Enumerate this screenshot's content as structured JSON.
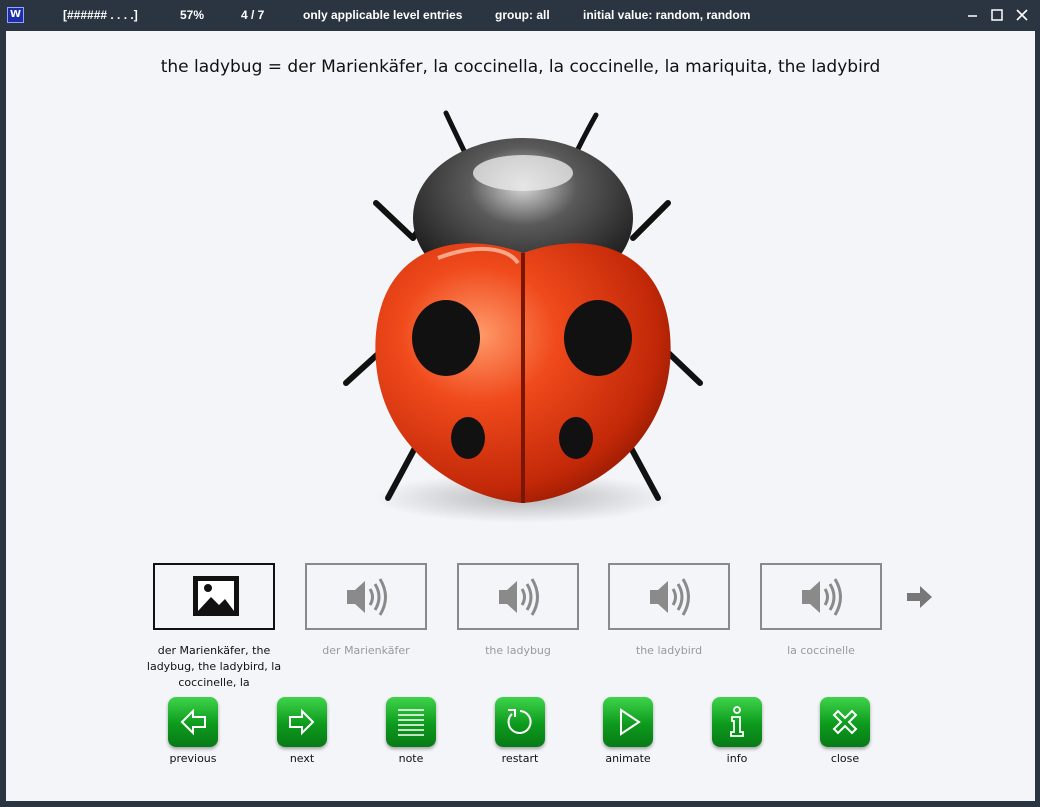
{
  "titlebar": {
    "app_icon_label": "W",
    "progress_text": "[###### . . . .]",
    "percent": "57%",
    "count": "4 / 7",
    "filter": "only applicable level entries",
    "group": "group: all",
    "initial_value": "initial value: random, random"
  },
  "heading": "the ladybug = der Marienkäfer, la coccinella, la coccinelle, la mariquita, the ladybird",
  "cards": [
    {
      "type": "image",
      "label": "der Marienkäfer, the ladybug, the ladybird, la coccinelle, la",
      "selected": true,
      "icon": "image-icon"
    },
    {
      "type": "audio",
      "label": "der Marienkäfer",
      "selected": false,
      "icon": "speaker-icon"
    },
    {
      "type": "audio",
      "label": "the ladybug",
      "selected": false,
      "icon": "speaker-icon"
    },
    {
      "type": "audio",
      "label": "the ladybird",
      "selected": false,
      "icon": "speaker-icon"
    },
    {
      "type": "audio",
      "label": "la coccinelle",
      "selected": false,
      "icon": "speaker-icon"
    }
  ],
  "scroll_icon": "arrow-right-icon",
  "buttons": [
    {
      "label": "previous",
      "icon": "arrow-left-icon"
    },
    {
      "label": "next",
      "icon": "arrow-right-icon"
    },
    {
      "label": "note",
      "icon": "lines-icon"
    },
    {
      "label": "restart",
      "icon": "restart-icon"
    },
    {
      "label": "animate",
      "icon": "play-icon"
    },
    {
      "label": "info",
      "icon": "info-icon"
    },
    {
      "label": "close",
      "icon": "close-x-icon"
    }
  ],
  "colors": {
    "accent_green": "#0d9a1d",
    "window_frame": "#2b3441",
    "canvas": "#f4f5f8"
  }
}
